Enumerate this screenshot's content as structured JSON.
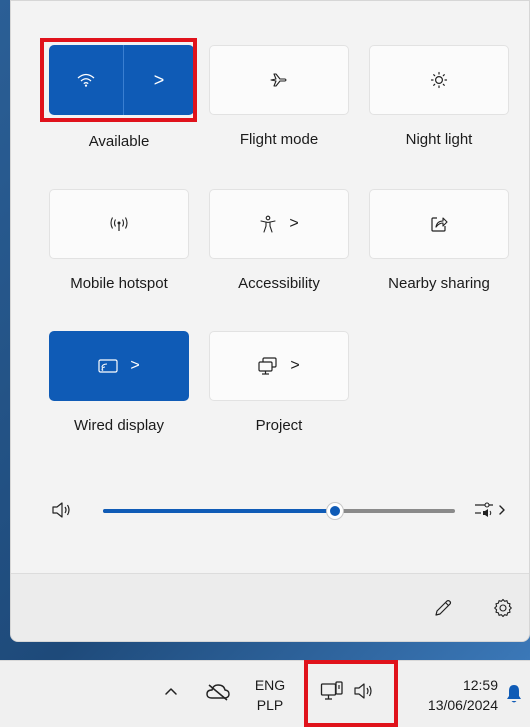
{
  "quick_settings": {
    "tiles": [
      {
        "id": "wifi",
        "label": "Available",
        "active": true,
        "has_chevron": true,
        "icon": "wifi-icon",
        "split": true
      },
      {
        "id": "flight",
        "label": "Flight mode",
        "active": false,
        "has_chevron": false,
        "icon": "airplane-icon"
      },
      {
        "id": "night",
        "label": "Night light",
        "active": false,
        "has_chevron": false,
        "icon": "brightness-icon"
      },
      {
        "id": "hotspot",
        "label": "Mobile hotspot",
        "active": false,
        "has_chevron": false,
        "icon": "hotspot-icon"
      },
      {
        "id": "accessibility",
        "label": "Accessibility",
        "active": false,
        "has_chevron": true,
        "icon": "accessibility-icon"
      },
      {
        "id": "nearby",
        "label": "Nearby sharing",
        "active": false,
        "has_chevron": false,
        "icon": "share-icon"
      },
      {
        "id": "wired",
        "label": "Wired display",
        "active": true,
        "has_chevron": true,
        "icon": "cast-icon"
      },
      {
        "id": "project",
        "label": "Project",
        "active": false,
        "has_chevron": true,
        "icon": "project-icon"
      }
    ],
    "chevron_glyph": ">",
    "volume": {
      "level_fraction": 0.66,
      "speaker_icon": "speaker-icon",
      "output_icon": "audio-output-icon"
    },
    "footer": {
      "edit_icon": "pencil-icon",
      "settings_icon": "gear-icon"
    }
  },
  "taskbar": {
    "chevron_glyph": "^",
    "language_line1": "ENG",
    "language_line2": "PLP",
    "time": "12:59",
    "date": "13/06/2024"
  },
  "colors": {
    "accent": "#0f5bb6",
    "highlight": "#e0121b"
  }
}
